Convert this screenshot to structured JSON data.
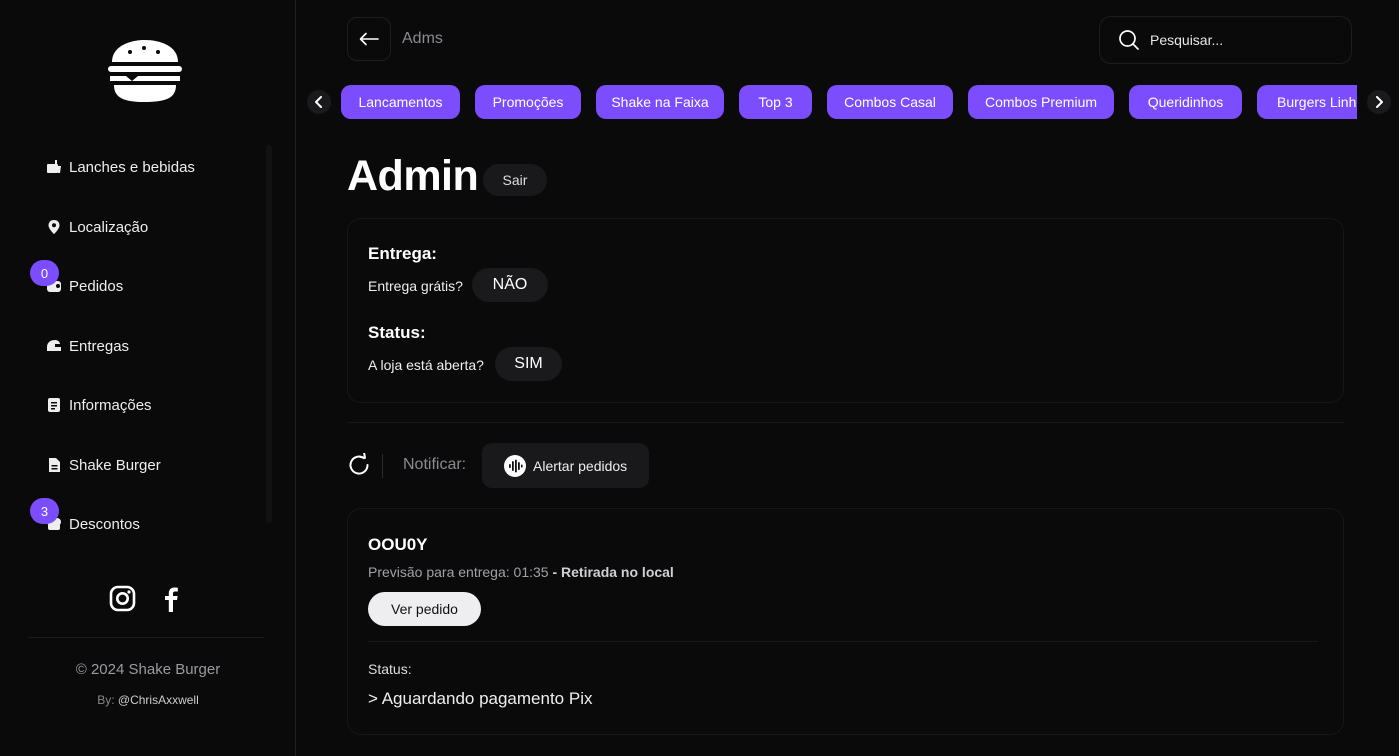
{
  "sidebar": {
    "items": [
      {
        "label": "Lanches e bebidas",
        "icon": "food-icon"
      },
      {
        "label": "Localização",
        "icon": "location-pin-icon"
      },
      {
        "label": "Pedidos",
        "icon": "orders-icon",
        "badge": "0"
      },
      {
        "label": "Entregas",
        "icon": "delivery-icon"
      },
      {
        "label": "Informações",
        "icon": "info-document-icon"
      },
      {
        "label": "Shake Burger",
        "icon": "file-icon"
      },
      {
        "label": "Descontos",
        "icon": "discount-icon",
        "badge": "3"
      }
    ],
    "socials": [
      "instagram-icon",
      "facebook-icon"
    ],
    "copyright": "© 2024 Shake Burger",
    "byline_prefix": "By:",
    "byline_handle": "@ChrisAxxwell"
  },
  "header": {
    "breadcrumb": "Adms",
    "search_placeholder": "Pesquisar..."
  },
  "categories": [
    "Lancamentos",
    "Promoções",
    "Shake na Faixa",
    "Top 3",
    "Combos Casal",
    "Combos Premium",
    "Queridinhos",
    "Burgers Linha"
  ],
  "admin": {
    "title": "Admin",
    "logout_label": "Sair",
    "delivery_title": "Entrega:",
    "delivery_question": "Entrega grátis?",
    "delivery_value": "NÃO",
    "status_title": "Status:",
    "status_question": "A loja está aberta?",
    "status_value": "SIM"
  },
  "notify": {
    "label": "Notificar:",
    "button_label": "Alertar pedidos"
  },
  "order": {
    "code": "OOU0Y",
    "eta_text": "Previsão para entrega: 01:35",
    "pickup_text": " - Retirada no local",
    "view_button": "Ver pedido",
    "status_label": "Status:",
    "status_value": "> Aguardando pagamento Pix"
  },
  "colors": {
    "accent": "#7c4dff",
    "background": "#0a0a0b",
    "surface": "#19191c"
  }
}
